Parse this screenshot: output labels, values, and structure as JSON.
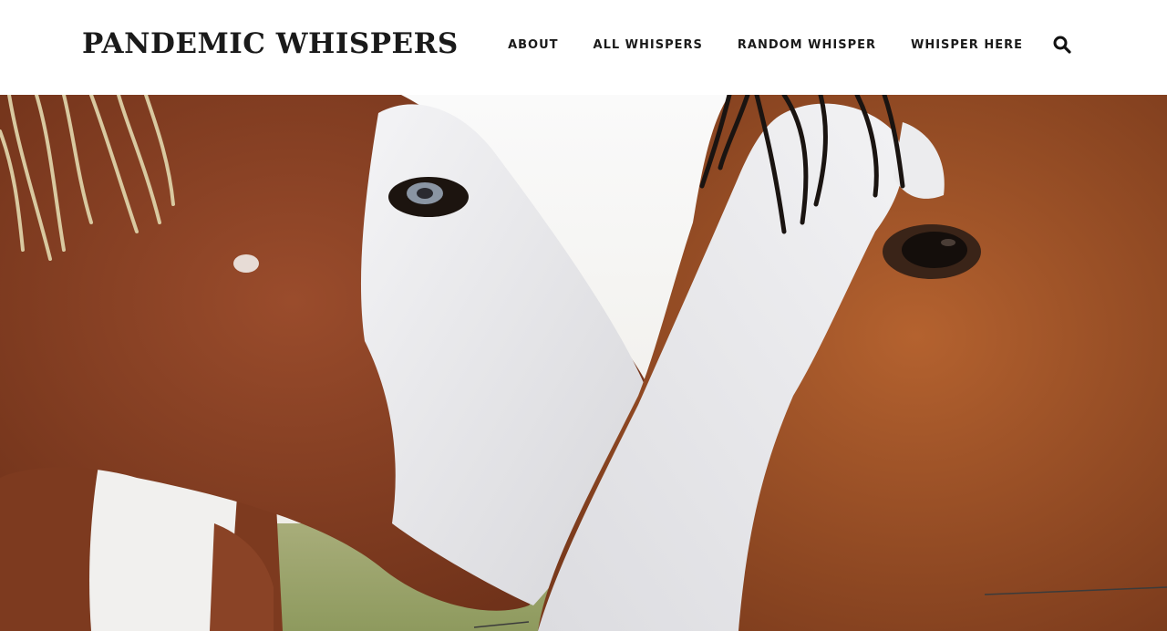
{
  "site": {
    "title": "PANDEMIC WHISPERS"
  },
  "nav": {
    "items": [
      {
        "label": "ABOUT"
      },
      {
        "label": "ALL WHISPERS"
      },
      {
        "label": "RANDOM WHISPER"
      },
      {
        "label": "WHISPER HERE"
      }
    ],
    "search_icon": "search-icon"
  },
  "hero": {
    "image": "two-horses-photo",
    "colors": {
      "chestnut": "#8a4326",
      "white_blaze": "#e8e8ea",
      "sky": "#f5f5f3",
      "grass": "#9aa36a"
    }
  }
}
